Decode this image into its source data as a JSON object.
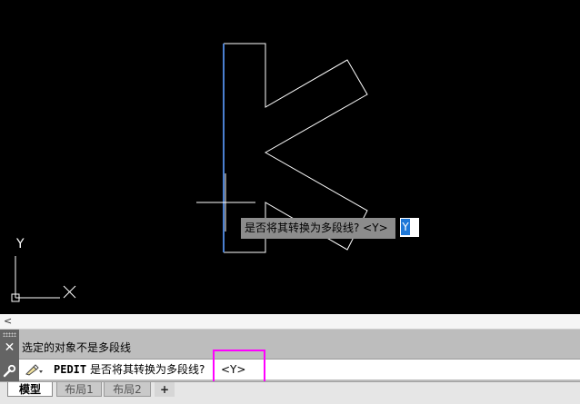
{
  "viewport": {
    "ucs_y_label": "Y",
    "dynamic_prompt_text": "是否将其转换为多段线? <Y>",
    "dynamic_input_value": "Y",
    "colors": {
      "background": "#000000",
      "geometry": "#ffffff",
      "selected_edge": "#4a7fd0",
      "highlight_box": "#ff00ff"
    }
  },
  "command_history": {
    "expand_icon": "chevron-left-icon",
    "history_text": "选定的对象不是多段线"
  },
  "command_line": {
    "close_label": "✕",
    "command_name": "PEDIT",
    "prompt_text": "是否将其转换为多段线?",
    "option_text": "<Y>"
  },
  "layout_tabs": {
    "model": "模型",
    "layout1": "布局1",
    "layout2": "布局2",
    "add_label": "+"
  }
}
